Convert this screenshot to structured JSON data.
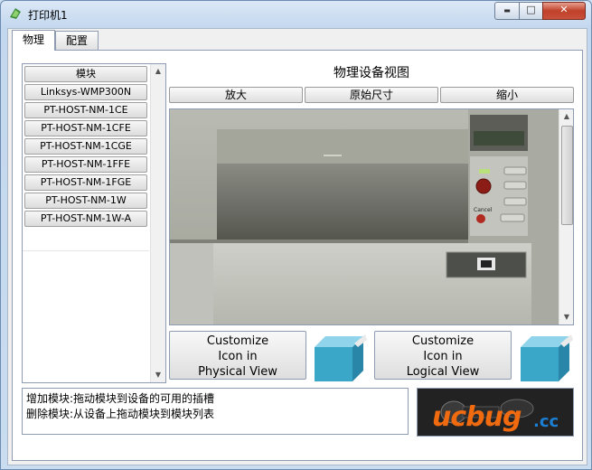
{
  "window": {
    "title": "打印机1",
    "minimize_glyph": "▬",
    "maximize_glyph": "□",
    "close_glyph": "✕"
  },
  "tabs": [
    {
      "label": "物理",
      "active": true
    },
    {
      "label": "配置",
      "active": false
    }
  ],
  "modules": {
    "header": "模块",
    "items": [
      "Linksys-WMP300N",
      "PT-HOST-NM-1CE",
      "PT-HOST-NM-1CFE",
      "PT-HOST-NM-1CGE",
      "PT-HOST-NM-1FFE",
      "PT-HOST-NM-1FGE",
      "PT-HOST-NM-1W",
      "PT-HOST-NM-1W-A"
    ]
  },
  "device_view": {
    "title": "物理设备视图",
    "zoom_in": "放大",
    "original_size": "原始尺寸",
    "zoom_out": "缩小",
    "cancel_label": "Cancel"
  },
  "customize": {
    "physical": [
      "Customize",
      "Icon in",
      "Physical View"
    ],
    "logical": [
      "Customize",
      "Icon in",
      "Logical View"
    ]
  },
  "info": {
    "line1": "增加模块:拖动模块到设备的可用的插槽",
    "line2": "删除模块:从设备上拖动模块到模块列表"
  },
  "watermark": {
    "top": "",
    "brand": "ucbug",
    "suffix": ".cc",
    "url": ""
  }
}
